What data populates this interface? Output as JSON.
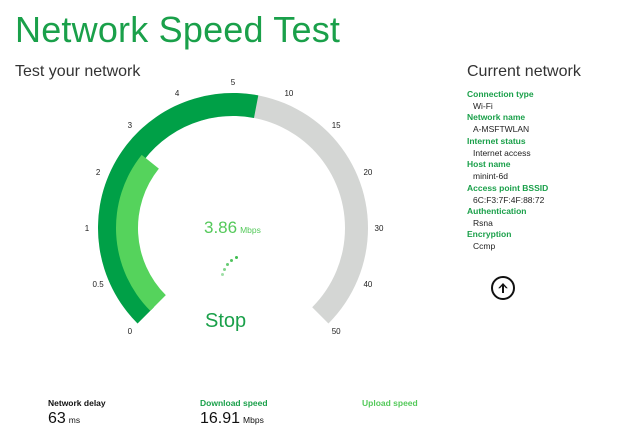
{
  "app": {
    "title": "Network Speed Test"
  },
  "test": {
    "heading": "Test your network",
    "current_speed": "3.86",
    "current_speed_unit": "Mbps",
    "stop_label": "Stop",
    "gauge": {
      "ticks": [
        "0",
        "0.5",
        "1",
        "2",
        "3",
        "4",
        "5",
        "10",
        "15",
        "20",
        "30",
        "40",
        "50"
      ],
      "scale_max": "50",
      "outer_progress_fraction": 0.54,
      "inner_progress_fraction": 0.31,
      "colors": {
        "outer_fill": "#00a047",
        "inner_fill": "#55d35c",
        "track": "#d4d6d4"
      }
    }
  },
  "current_network": {
    "heading": "Current network",
    "items": [
      {
        "label": "Connection type",
        "value": "Wi-Fi"
      },
      {
        "label": "Network name",
        "value": "A-MSFTWLAN"
      },
      {
        "label": "Internet status",
        "value": "Internet access"
      },
      {
        "label": "Host name",
        "value": "minint-6d"
      },
      {
        "label": "Access point BSSID",
        "value": "6C:F3:7F:4F:88:72"
      },
      {
        "label": "Authentication",
        "value": "Rsna"
      },
      {
        "label": "Encryption",
        "value": "Ccmp"
      }
    ],
    "action_icon": "circle-arrow-up-icon"
  },
  "stats": {
    "delay": {
      "label": "Network delay",
      "value": "63",
      "unit": "ms"
    },
    "download": {
      "label": "Download speed",
      "value": "16.91",
      "unit": "Mbps"
    },
    "upload": {
      "label": "Upload speed"
    }
  },
  "colors": {
    "accent": "#1aa04a",
    "accent_light": "#54c95a",
    "text": "#222222"
  }
}
